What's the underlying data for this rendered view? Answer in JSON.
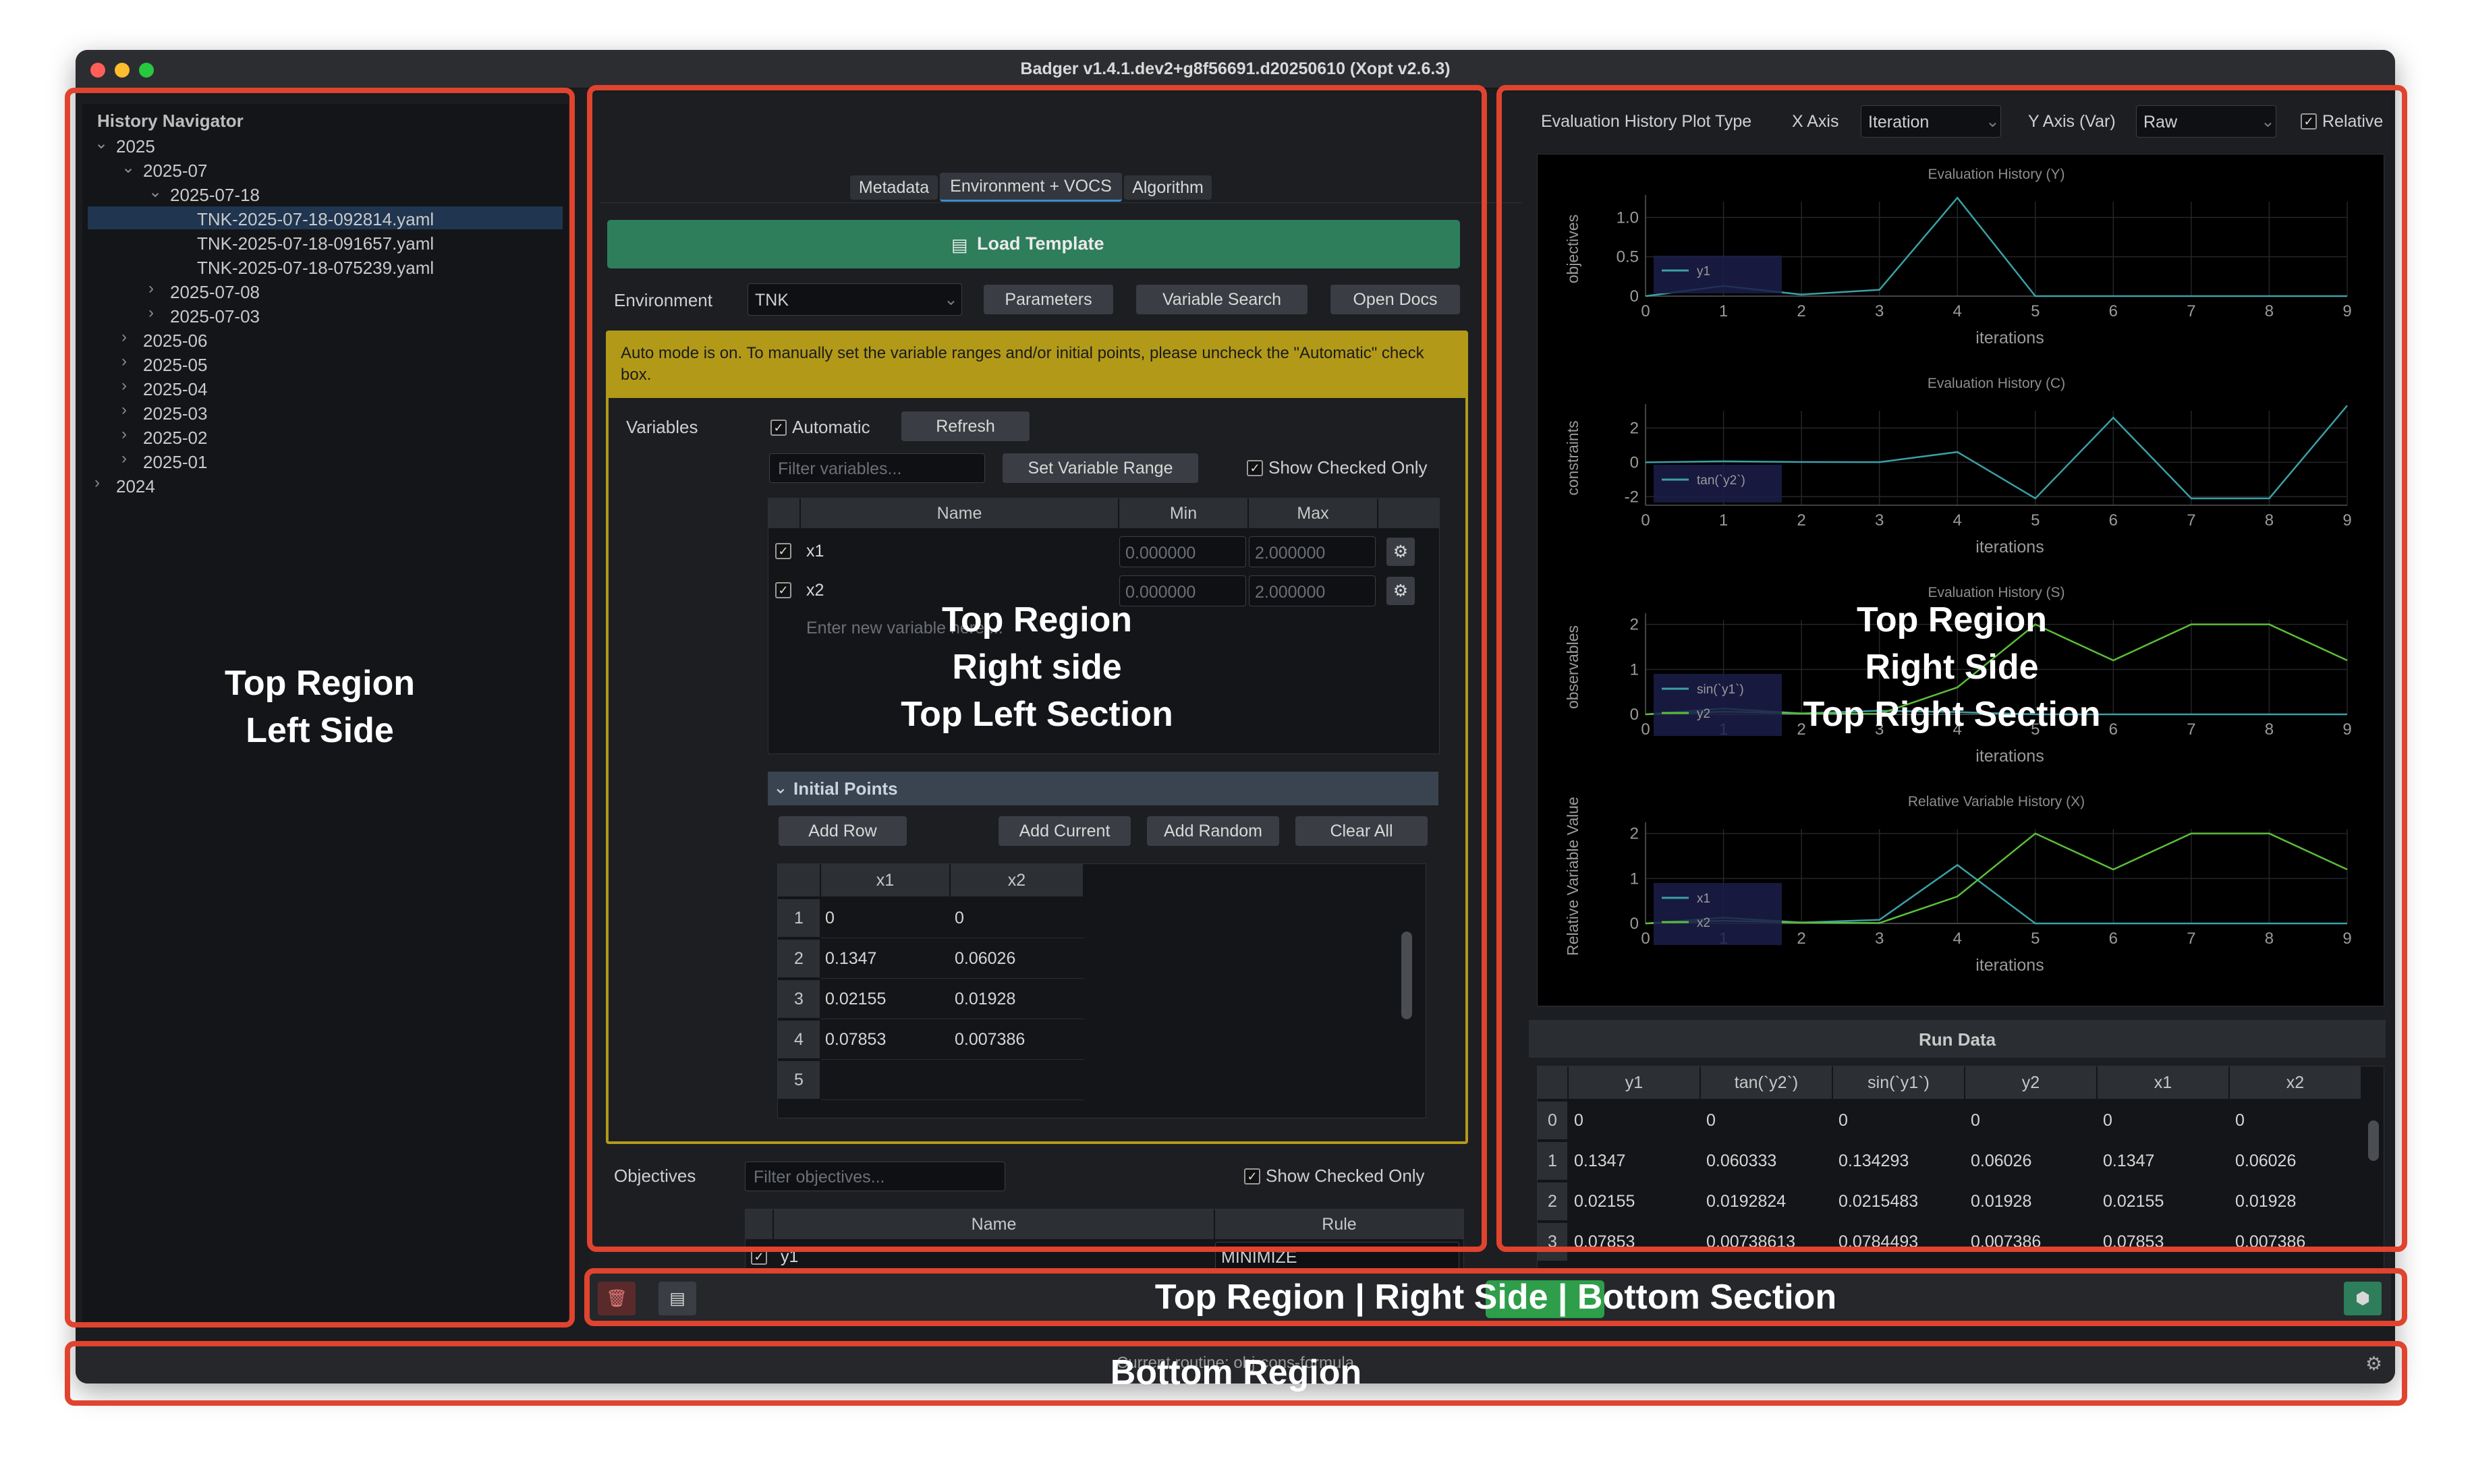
{
  "window": {
    "title": "Badger v1.4.1.dev2+g8f56691.d20250610 (Xopt v2.6.3)"
  },
  "history": {
    "title": "History Navigator",
    "items": [
      {
        "label": "2025",
        "arrow": "⌄"
      },
      {
        "label": "2025-07",
        "arrow": "⌄"
      },
      {
        "label": "2025-07-18",
        "arrow": "⌄"
      },
      {
        "label": "TNK-2025-07-18-092814.yaml"
      },
      {
        "label": "TNK-2025-07-18-091657.yaml"
      },
      {
        "label": "TNK-2025-07-18-075239.yaml"
      },
      {
        "label": "2025-07-08",
        "arrow": "›"
      },
      {
        "label": "2025-07-03",
        "arrow": "›"
      },
      {
        "label": "2025-06",
        "arrow": "›"
      },
      {
        "label": "2025-05",
        "arrow": "›"
      },
      {
        "label": "2025-04",
        "arrow": "›"
      },
      {
        "label": "2025-03",
        "arrow": "›"
      },
      {
        "label": "2025-02",
        "arrow": "›"
      },
      {
        "label": "2025-01",
        "arrow": "›"
      },
      {
        "label": "2024",
        "arrow": "›"
      }
    ]
  },
  "tabs": [
    "Metadata",
    "Environment + VOCS",
    "Algorithm"
  ],
  "env": {
    "load_template": "Load Template",
    "env_label": "Environment",
    "env_value": "TNK",
    "parameters": "Parameters",
    "variable_search": "Variable Search",
    "open_docs": "Open Docs",
    "auto_notice": "Auto mode is on.  To manually set the variable ranges and/or initial points,  please uncheck the \"Automatic\" check box.",
    "variables_label": "Variables",
    "automatic": "Automatic",
    "refresh": "Refresh",
    "filter_variables": "Filter variables...",
    "set_variable_range": "Set Variable Range",
    "show_checked_only": "Show Checked Only",
    "var_headers": [
      "Name",
      "Min",
      "Max"
    ],
    "variables": [
      {
        "check": "✓",
        "name": "x1",
        "min": "0.000000",
        "max": "2.000000"
      },
      {
        "check": "✓",
        "name": "x2",
        "min": "0.000000",
        "max": "2.000000"
      }
    ],
    "new_variable_placeholder": "Enter new variable here....",
    "initial_points_label": "Initial Points",
    "add_row": "Add Row",
    "add_current": "Add Current",
    "add_random": "Add Random",
    "clear_all": "Clear All",
    "ip_headers": [
      "x1",
      "x2"
    ],
    "ip_rows": [
      {
        "idx": "1",
        "x1": "0",
        "x2": "0"
      },
      {
        "idx": "2",
        "x1": "0.1347",
        "x2": "0.06026"
      },
      {
        "idx": "3",
        "x1": "0.02155",
        "x2": "0.01928"
      },
      {
        "idx": "4",
        "x1": "0.07853",
        "x2": "0.007386"
      },
      {
        "idx": "5",
        "x1": "",
        "x2": ""
      }
    ],
    "objectives_label": "Objectives",
    "filter_objectives": "Filter objectives...",
    "obj_headers": [
      "Name",
      "Rule"
    ],
    "objectives": [
      {
        "check": "✓",
        "name": "y1",
        "rule": "MINIMIZE"
      }
    ]
  },
  "plot_controls": {
    "plot_type": "Evaluation History Plot Type",
    "x_axis": "X Axis",
    "x_value": "Iteration",
    "y_axis": "Y Axis (Var)",
    "y_value": "Raw",
    "relative": "Relative"
  },
  "chart_data": [
    {
      "type": "line",
      "title": "Evaluation History (Y)",
      "xlabel": "iterations",
      "ylabel": "objectives",
      "x": [
        0,
        1,
        2,
        3,
        4,
        5,
        6,
        7,
        8,
        9
      ],
      "xlim": [
        0,
        9
      ],
      "ylim": [
        0,
        1.2
      ],
      "yticks": [
        "1.0",
        "0.5",
        "0"
      ],
      "series": [
        {
          "name": "y1",
          "color": "#3aa0a6",
          "values": [
            0,
            0.13,
            0.02,
            0.08,
            1.25,
            0,
            0,
            0,
            0,
            0
          ]
        }
      ]
    },
    {
      "type": "line",
      "title": "Evaluation History (C)",
      "xlabel": "iterations",
      "ylabel": "constraints",
      "x": [
        0,
        1,
        2,
        3,
        4,
        5,
        6,
        7,
        8,
        9
      ],
      "xlim": [
        0,
        9
      ],
      "ylim": [
        -2.5,
        3.0
      ],
      "yticks": [
        "2",
        "0",
        "-2"
      ],
      "series": [
        {
          "name": "tan(`y2`)",
          "color": "#3aa0a6",
          "values": [
            0,
            0.06,
            0.02,
            0.01,
            0.6,
            -2.1,
            2.6,
            -2.1,
            -2.1,
            3.3
          ]
        }
      ]
    },
    {
      "type": "line",
      "title": "Evaluation History (S)",
      "xlabel": "iterations",
      "ylabel": "observables",
      "x": [
        0,
        1,
        2,
        3,
        4,
        5,
        6,
        7,
        8,
        9
      ],
      "xlim": [
        0,
        9
      ],
      "ylim": [
        0,
        2.1
      ],
      "yticks": [
        "2",
        "1",
        "0"
      ],
      "series": [
        {
          "name": "sin(`y1`)",
          "color": "#3aa0a6",
          "values": [
            0,
            0.13,
            0.02,
            0.08,
            0.05,
            0,
            0,
            0,
            0,
            0
          ]
        },
        {
          "name": "y2",
          "color": "#5bbf3a",
          "values": [
            0,
            0.06,
            0.02,
            0.01,
            0.6,
            2.0,
            1.2,
            2.0,
            2.0,
            1.2
          ]
        }
      ]
    },
    {
      "type": "line",
      "title": "Relative Variable History (X)",
      "xlabel": "iterations",
      "ylabel": "Relative Variable Value",
      "x": [
        0,
        1,
        2,
        3,
        4,
        5,
        6,
        7,
        8,
        9
      ],
      "xlim": [
        0,
        9
      ],
      "ylim": [
        0,
        2.1
      ],
      "yticks": [
        "2",
        "1",
        "0"
      ],
      "series": [
        {
          "name": "x1",
          "color": "#3aa0a6",
          "values": [
            0,
            0.13,
            0.02,
            0.08,
            1.3,
            0,
            0,
            0,
            0,
            0
          ]
        },
        {
          "name": "x2",
          "color": "#5bbf3a",
          "values": [
            0,
            0.06,
            0.02,
            0.01,
            0.6,
            2.0,
            1.2,
            2.0,
            2.0,
            1.2
          ]
        }
      ]
    }
  ],
  "run_data": {
    "title": "Run Data",
    "headers": [
      "y1",
      "tan(`y2`)",
      "sin(`y1`)",
      "y2",
      "x1",
      "x2"
    ],
    "rows": [
      {
        "idx": "0",
        "cells": [
          "0",
          "0",
          "0",
          "0",
          "0",
          "0"
        ]
      },
      {
        "idx": "1",
        "cells": [
          "0.1347",
          "0.060333",
          "0.134293",
          "0.06026",
          "0.1347",
          "0.06026"
        ]
      },
      {
        "idx": "2",
        "cells": [
          "0.02155",
          "0.0192824",
          "0.0215483",
          "0.01928",
          "0.02155",
          "0.01928"
        ]
      },
      {
        "idx": "3",
        "cells": [
          "0.07853",
          "0.00738613",
          "0.0784493",
          "0.007386",
          "0.07853",
          "0.007386"
        ]
      }
    ]
  },
  "status": {
    "routine": "Current routine: obj-cons-formula"
  },
  "overlays": {
    "left": [
      "Top Region",
      "Left Side"
    ],
    "mid": [
      "Top Region",
      "Right side",
      "Top Left Section"
    ],
    "right": [
      "Top Region",
      "Right Side",
      "Top Right Section"
    ],
    "bottom_section": "Top Region | Right Side | Bottom Section",
    "bottom_region": "Bottom Region"
  },
  "colors": {
    "accent_green": "#2e7d5b",
    "notice_yellow": "#b29a18",
    "overlay_red": "#e0432e",
    "series_teal": "#3aa0a6",
    "series_green": "#5bbf3a"
  }
}
